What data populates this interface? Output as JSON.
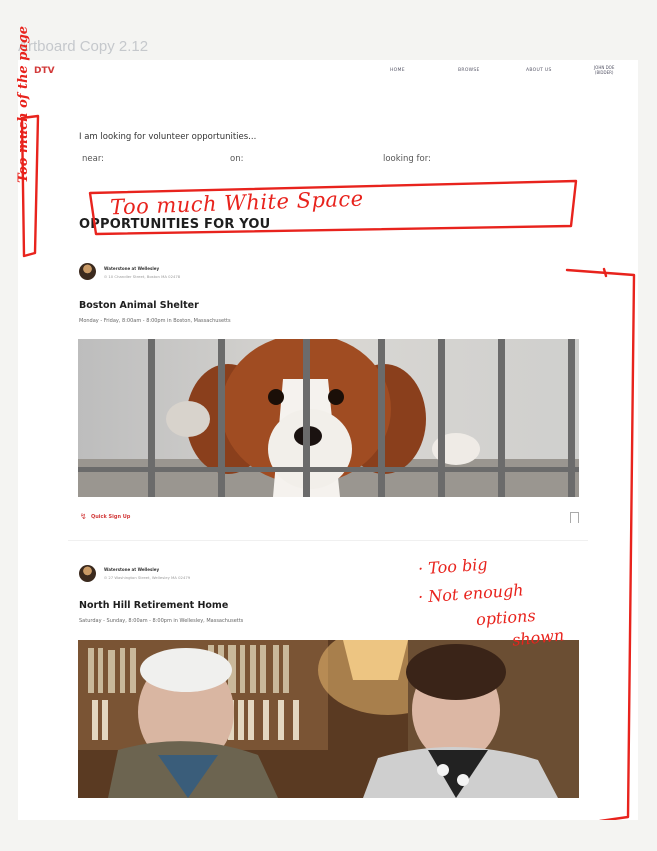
{
  "artboard_title": "Artboard Copy 2.12",
  "nav": {
    "brand": "DTV",
    "links": [
      "HOME",
      "BROWSE",
      "ABOUT US"
    ],
    "user_name": "JOHN DOE",
    "user_sub": "(BIDDER)"
  },
  "search": {
    "prompt": "I am looking for volunteer opportunities...",
    "near_label": "near:",
    "on_label": "on:",
    "looking_label": "looking for:"
  },
  "section_title": "OPPORTUNITIES FOR YOU",
  "cards": [
    {
      "org": "Waterstone at Wellesley",
      "address": "⊙ 10 Chandler Street, Boston MA 02478",
      "title": "Boston Animal Shelter",
      "time": "Monday - Friday, 8:00am - 8:00pm in Boston, Massachusetts",
      "quick_signup": "Quick Sign Up"
    },
    {
      "org": "Waterstone at Wellesley",
      "address": "⊙ 27 Washington Street, Wellesley MA 02479",
      "title": "North Hill Retirement Home",
      "time": "Saturday - Sunday, 8:00am - 8:00pm in Wellesley, Massachusetts"
    }
  ],
  "annotations": {
    "margin_note": "Too much of the page",
    "white_space": "Too much White Space",
    "note_big": "· Too big",
    "note_options_1": "· Not enough",
    "note_options_2": "options",
    "note_options_3": "shown"
  },
  "colors": {
    "accent": "#d23a3a",
    "ink": "#e8231d"
  }
}
